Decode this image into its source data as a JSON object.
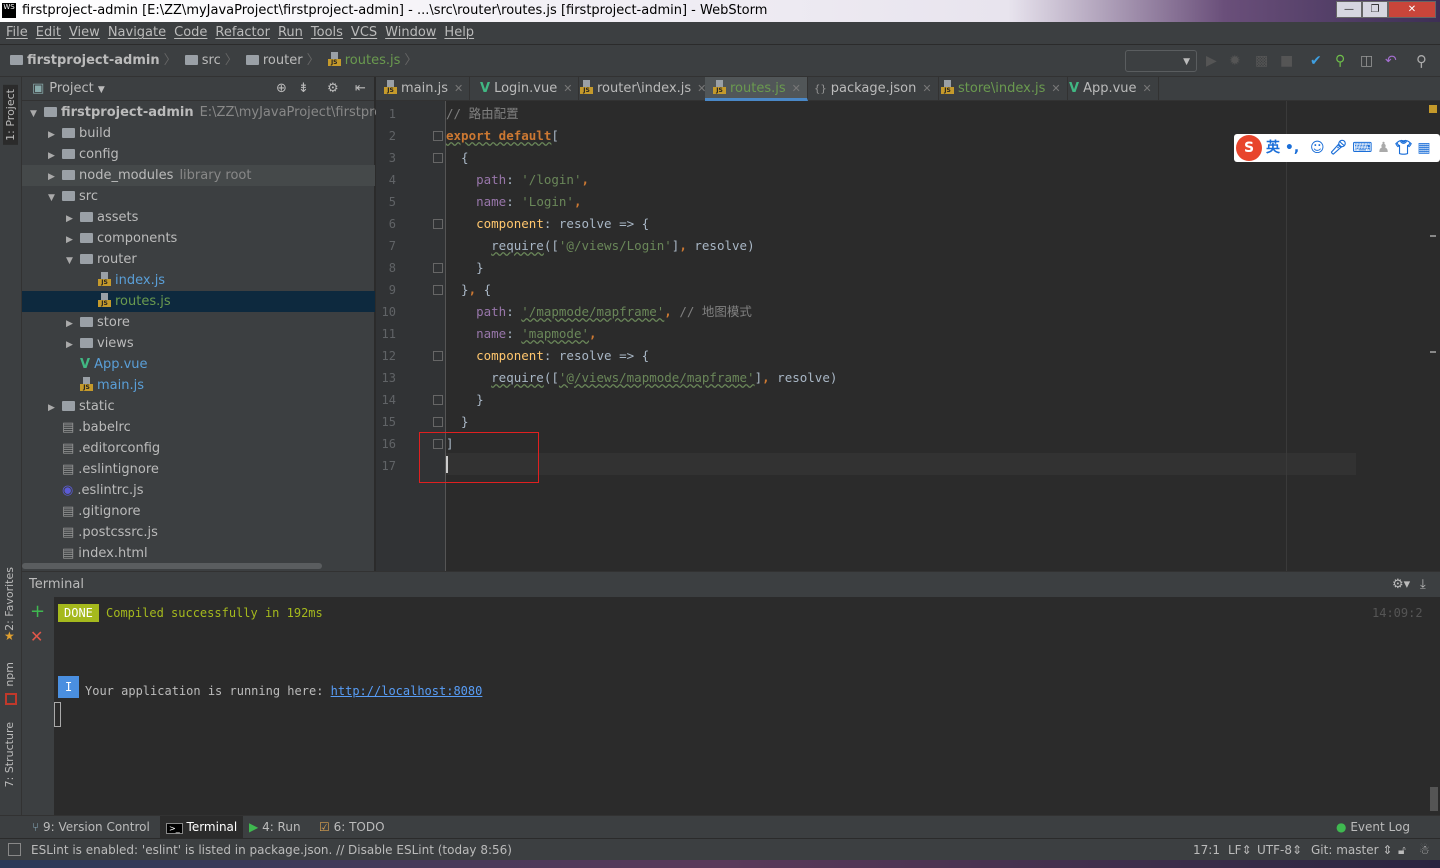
{
  "window": {
    "title": "firstproject-admin [E:\\ZZ\\myJavaProject\\firstproject-admin] - ...\\src\\router\\routes.js [firstproject-admin] - WebStorm",
    "app_icon": "WS"
  },
  "menu": [
    "File",
    "Edit",
    "View",
    "Navigate",
    "Code",
    "Refactor",
    "Run",
    "Tools",
    "VCS",
    "Window",
    "Help"
  ],
  "breadcrumb": [
    "firstproject-admin",
    "src",
    "router",
    "routes.js"
  ],
  "project_panel": {
    "title": "Project",
    "tree": [
      {
        "label": "firstproject-admin",
        "extra": "E:\\ZZ\\myJavaProject\\firstproject-a",
        "type": "folder",
        "level": 0,
        "open": true,
        "bold": true
      },
      {
        "label": "build",
        "type": "folder",
        "level": 1
      },
      {
        "label": "config",
        "type": "folder",
        "level": 1
      },
      {
        "label": "node_modules",
        "extra": "library root",
        "type": "folder",
        "level": 1,
        "highlight": true
      },
      {
        "label": "src",
        "type": "folder",
        "level": 1,
        "open": true
      },
      {
        "label": "assets",
        "type": "folder",
        "level": 2
      },
      {
        "label": "components",
        "type": "folder",
        "level": 2
      },
      {
        "label": "router",
        "type": "folder",
        "level": 2,
        "open": true
      },
      {
        "label": "index.js",
        "type": "js",
        "level": 3
      },
      {
        "label": "routes.js",
        "type": "js",
        "level": 3,
        "selected": true
      },
      {
        "label": "store",
        "type": "folder",
        "level": 2
      },
      {
        "label": "views",
        "type": "folder",
        "level": 2
      },
      {
        "label": "App.vue",
        "type": "vue",
        "level": 2
      },
      {
        "label": "main.js",
        "type": "js",
        "level": 2
      },
      {
        "label": "static",
        "type": "folder",
        "level": 1
      },
      {
        "label": ".babelrc",
        "type": "file",
        "level": 1
      },
      {
        "label": ".editorconfig",
        "type": "file",
        "level": 1
      },
      {
        "label": ".eslintignore",
        "type": "file",
        "level": 1
      },
      {
        "label": ".eslintrc.js",
        "type": "eslint",
        "level": 1
      },
      {
        "label": ".gitignore",
        "type": "file",
        "level": 1
      },
      {
        "label": ".postcssrc.js",
        "type": "file",
        "level": 1
      },
      {
        "label": "index.html",
        "type": "file",
        "level": 1
      }
    ]
  },
  "tabs": [
    {
      "label": "main.js",
      "type": "js"
    },
    {
      "label": "Login.vue",
      "type": "vue"
    },
    {
      "label": "router\\index.js",
      "type": "js"
    },
    {
      "label": "routes.js",
      "type": "js",
      "active": true
    },
    {
      "label": "package.json",
      "type": "json"
    },
    {
      "label": "store\\index.js",
      "type": "js"
    },
    {
      "label": "App.vue",
      "type": "vue"
    }
  ],
  "editor": {
    "lines": [
      [
        [
          "t-cm",
          "// 路由配置"
        ]
      ],
      [
        [
          "t-kw t-sq",
          "export default"
        ],
        [
          "t-pl",
          "["
        ]
      ],
      [
        [
          "t-pl",
          "  {"
        ]
      ],
      [
        [
          "t-pl",
          "    "
        ],
        [
          "t-prop",
          "path"
        ],
        [
          "t-pl",
          ": "
        ],
        [
          "t-str",
          "'/login'"
        ],
        [
          "t-kw",
          ","
        ]
      ],
      [
        [
          "t-pl",
          "    "
        ],
        [
          "t-prop",
          "name"
        ],
        [
          "t-pl",
          ": "
        ],
        [
          "t-str",
          "'Login'"
        ],
        [
          "t-kw",
          ","
        ]
      ],
      [
        [
          "t-pl",
          "    "
        ],
        [
          "t-fn",
          "component"
        ],
        [
          "t-pl",
          ": resolve => {"
        ]
      ],
      [
        [
          "t-pl",
          "      "
        ],
        [
          "t-pl t-sq",
          "require"
        ],
        [
          "t-pl",
          "(["
        ],
        [
          "t-str",
          "'@/views/Login'"
        ],
        [
          "t-pl",
          "]"
        ],
        [
          "t-kw",
          ","
        ],
        [
          "t-pl",
          " resolve)"
        ]
      ],
      [
        [
          "t-pl",
          "    }"
        ]
      ],
      [
        [
          "t-pl",
          "  }"
        ],
        [
          "t-kw",
          ","
        ],
        [
          "t-pl",
          " {"
        ]
      ],
      [
        [
          "t-pl",
          "    "
        ],
        [
          "t-prop",
          "path"
        ],
        [
          "t-pl",
          ": "
        ],
        [
          "t-str t-sq",
          "'/mapmode/mapframe'"
        ],
        [
          "t-kw",
          ","
        ],
        [
          "t-cm",
          " // 地图模式"
        ]
      ],
      [
        [
          "t-pl",
          "    "
        ],
        [
          "t-prop",
          "name"
        ],
        [
          "t-pl",
          ": "
        ],
        [
          "t-str t-sq",
          "'mapmode'"
        ],
        [
          "t-kw",
          ","
        ]
      ],
      [
        [
          "t-pl",
          "    "
        ],
        [
          "t-fn",
          "component"
        ],
        [
          "t-pl",
          ": resolve => {"
        ]
      ],
      [
        [
          "t-pl",
          "      "
        ],
        [
          "t-pl t-sq",
          "require"
        ],
        [
          "t-pl",
          "(["
        ],
        [
          "t-str t-sq",
          "'@/views/mapmode/mapframe'"
        ],
        [
          "t-pl",
          "]"
        ],
        [
          "t-kw",
          ","
        ],
        [
          "t-pl",
          " resolve)"
        ]
      ],
      [
        [
          "t-pl",
          "    }"
        ]
      ],
      [
        [
          "t-pl",
          "  }"
        ]
      ],
      [
        [
          "t-pl",
          "]"
        ]
      ],
      [
        [
          "t-pl",
          ""
        ]
      ]
    ]
  },
  "ime": {
    "mode": "英",
    "punct": "•,"
  },
  "terminal": {
    "title": "Terminal",
    "done_badge": "DONE",
    "compiled": "Compiled successfully in 192ms",
    "time": "14:09:2",
    "info_badge": "I",
    "running_text": "Your application is running here: ",
    "url": "http://localhost:8080"
  },
  "side_tabs": [
    "1: Project",
    "2: Favorites",
    "npm",
    "7: Structure"
  ],
  "tool_windows": [
    {
      "label": "9: Version Control"
    },
    {
      "label": "Terminal",
      "active": true
    },
    {
      "label": "4: Run"
    },
    {
      "label": "6: TODO"
    }
  ],
  "event_log": "Event Log",
  "status": {
    "message": "ESLint is enabled: 'eslint' is listed in package.json. // Disable ESLint (today 8:56)",
    "position": "17:1",
    "line_sep": "LF",
    "encoding": "UTF-8",
    "git": "Git: master"
  }
}
